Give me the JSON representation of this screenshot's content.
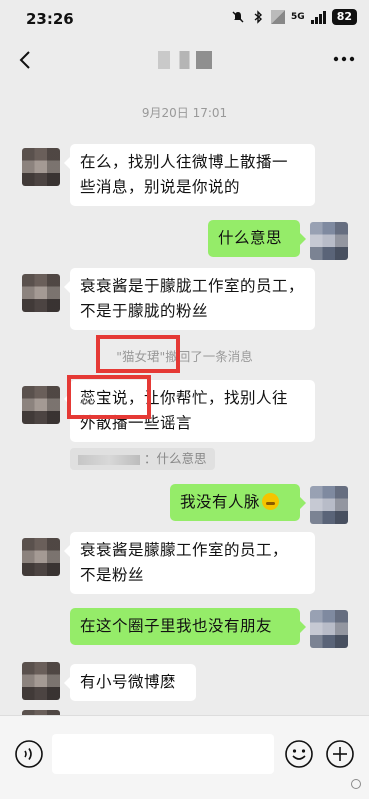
{
  "status_bar": {
    "time": "23:26",
    "network": "5G",
    "battery": "82"
  },
  "nav": {
    "back_icon": "chevron-left-icon",
    "more_icon": "more-dots-icon"
  },
  "chat": {
    "timestamp": "9月20日 17:01",
    "messages": [
      {
        "side": "in",
        "lines": [
          "在么，找别人往微博上散播一",
          "些消息，别说是你说的"
        ]
      },
      {
        "side": "me",
        "lines": [
          "什么意思"
        ]
      },
      {
        "side": "in",
        "lines": [
          "衰衰酱是于朦胧工作室的员工，",
          "不是于朦胧的粉丝"
        ]
      },
      {
        "side": "in",
        "lines": [
          "蕊宝说，让你帮忙，找别人往",
          "外散播一些谣言"
        ]
      },
      {
        "side": "me",
        "lines": [
          "我没有人脉"
        ]
      },
      {
        "side": "in",
        "lines": [
          "衰衰酱是朦朦工作室的员工，",
          "不是粉丝"
        ]
      },
      {
        "side": "me",
        "lines": [
          "在这个圈子里我也没有朋友"
        ]
      },
      {
        "side": "in",
        "lines": [
          "有小号微博麽"
        ]
      }
    ],
    "recall_notice": "\"猫女珺\"撤回了一条消息",
    "quote_text": "：什么意思"
  },
  "input_bar": {
    "placeholder": "",
    "voice_icon": "voice-icon",
    "emoji_icon": "emoji-icon",
    "plus_icon": "plus-icon"
  },
  "colors": {
    "background": "#ececec",
    "outgoing_bubble": "#95ec69",
    "incoming_bubble": "#ffffff",
    "highlight_box": "#e53935"
  }
}
